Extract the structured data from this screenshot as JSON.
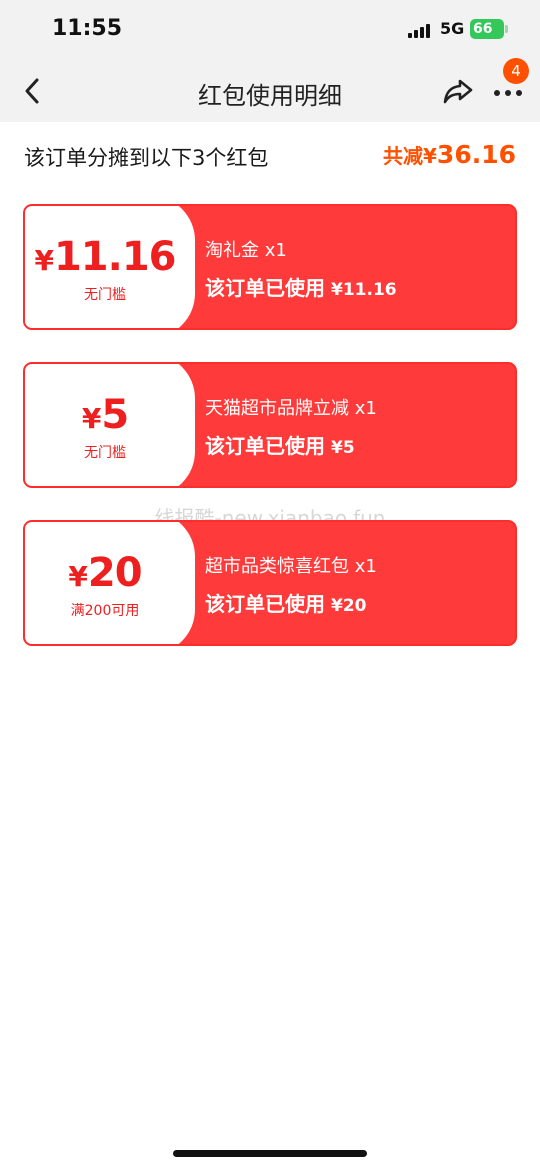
{
  "status_bar": {
    "time": "11:55",
    "network": "5G",
    "battery": "66"
  },
  "nav": {
    "title": "红包使用明细",
    "badge_count": "4"
  },
  "summary": {
    "text": "该订单分摊到以下3个红包",
    "total_label": "共减",
    "total_currency": "¥",
    "total_amount": "36.16"
  },
  "coupons": [
    {
      "currency": "¥",
      "amount": "11.16",
      "condition": "无门槛",
      "name": "淘礼金 x1",
      "used_label": "该订单已使用",
      "used_value": "¥11.16"
    },
    {
      "currency": "¥",
      "amount": "5",
      "condition": "无门槛",
      "name": "天猫超市品牌立减 x1",
      "used_label": "该订单已使用",
      "used_value": "¥5"
    },
    {
      "currency": "¥",
      "amount": "20",
      "condition": "满200可用",
      "name": "超市品类惊喜红包 x1",
      "used_label": "该订单已使用",
      "used_value": "¥20"
    }
  ],
  "watermark": "线报酷-new.xianbao.fun",
  "colors": {
    "accent": "#ff5000",
    "coupon_red": "#ff3a3a",
    "stub_text": "#ee1f1f"
  },
  "icons": {
    "back": "chevron-left-icon",
    "share": "share-icon",
    "more": "more-dots-icon"
  }
}
